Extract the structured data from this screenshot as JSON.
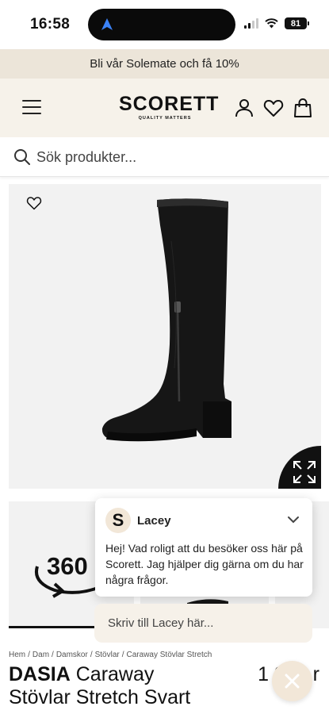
{
  "status_bar": {
    "time": "16:58",
    "battery": "81"
  },
  "promo": {
    "text": "Bli vår Solemate och få 10%"
  },
  "header": {
    "logo": "SCORETT",
    "tagline": "QUALITY MATTERS"
  },
  "search": {
    "placeholder": "Sök produkter..."
  },
  "gallery": {
    "thumb_label": "360"
  },
  "breadcrumb": [
    "Hem",
    "Dam",
    "Damskor",
    "Stövlar",
    "Caraway Stövlar Stretch"
  ],
  "product": {
    "brand": "DASIA",
    "name": "Caraway Stövlar Stretch Svart",
    "price": "1 90...r"
  },
  "chat": {
    "avatar_letter": "S",
    "agent_name": "Lacey",
    "message": "Hej! Vad roligt att du besöker oss här på Scorett. Jag hjälper dig gärna om du har några frågor.",
    "input_placeholder": "Skriv till Lacey här..."
  },
  "colors": {
    "promo_bg": "#ece5d9",
    "header_bg": "#f6f2ea",
    "chat_accent": "#f2e7d8",
    "image_bg": "#f2f2f2"
  }
}
